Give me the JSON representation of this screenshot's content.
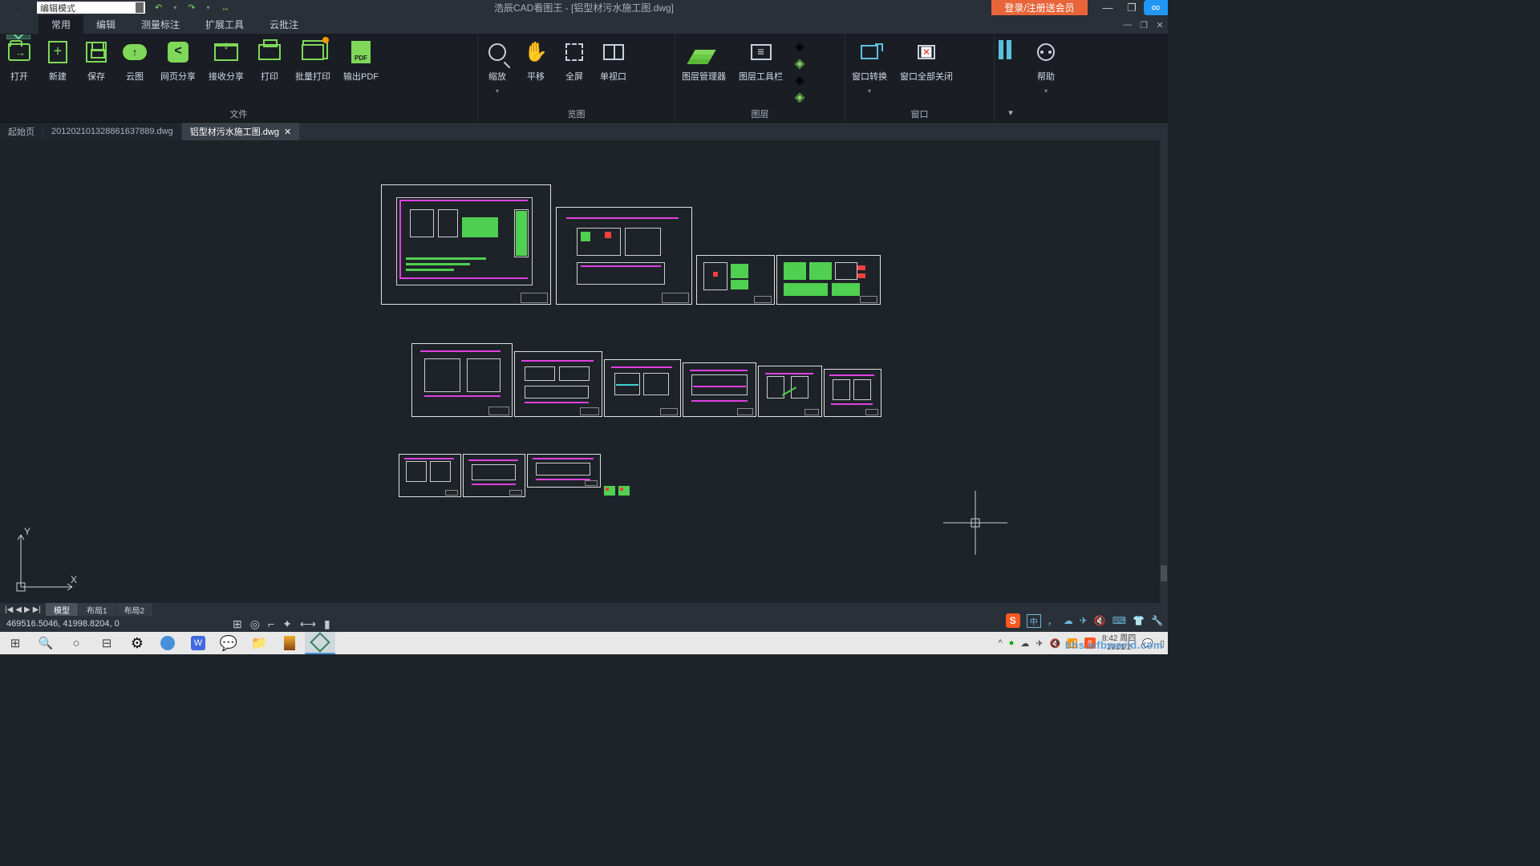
{
  "titlebar": {
    "mode": "编辑模式",
    "app_title": "浩辰CAD看图王 - [铝型材污水施工图.dwg]",
    "login": "登录/注册送会员"
  },
  "menu_tabs": [
    "常用",
    "编辑",
    "测量标注",
    "扩展工具",
    "云批注"
  ],
  "menu_active": 0,
  "ribbon": {
    "groups": [
      {
        "label": "文件",
        "buttons": [
          "打开",
          "新建",
          "保存",
          "云图",
          "网页分享",
          "接收分享",
          "打印",
          "批量打印",
          "输出PDF"
        ]
      },
      {
        "label": "览图",
        "buttons": [
          "缩放",
          "平移",
          "全屏",
          "单视口"
        ]
      },
      {
        "label": "图层",
        "buttons": [
          "图层管理器",
          "图层工具栏"
        ]
      },
      {
        "label": "窗口",
        "buttons": [
          "窗口转换",
          "窗口全部关闭"
        ]
      },
      {
        "label": "",
        "buttons": [
          "帮助"
        ]
      }
    ]
  },
  "doc_tabs": [
    {
      "label": "起始页",
      "active": false,
      "closable": false
    },
    {
      "label": "201202101328861637889.dwg",
      "active": false,
      "closable": false
    },
    {
      "label": "铝型材污水施工图.dwg",
      "active": true,
      "closable": true
    }
  ],
  "layout_tabs": [
    "模型",
    "布局1",
    "布局2"
  ],
  "layout_active": 0,
  "status": {
    "coords": "469516.5046, 41998.8204, 0"
  },
  "ucs": {
    "x": "X",
    "y": "Y"
  },
  "taskbar": {
    "clock_time": "8:42 周四",
    "clock_date": "2021/2",
    "watermark": "bhs.wfbworld.com"
  },
  "ime": {
    "engine": "S",
    "lang": "中"
  }
}
